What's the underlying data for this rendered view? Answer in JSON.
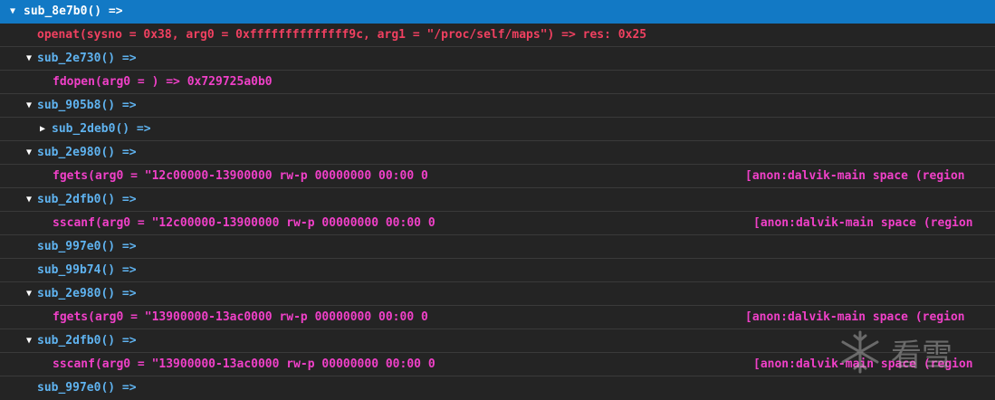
{
  "rows": [
    {
      "fn": "sub_8e7b0() =>",
      "arrow": "down"
    },
    {
      "call": "openat(sysno = 0x38, arg0 = 0xffffffffffffff9c, arg1 = \"/proc/self/maps\") => res: 0x25"
    },
    {
      "fn": "sub_2e730() =>",
      "arrow": "down"
    },
    {
      "call": "fdopen(arg0 = ) => 0x729725a0b0"
    },
    {
      "fn": "sub_905b8() =>",
      "arrow": "down"
    },
    {
      "fn": "sub_2deb0() =>",
      "arrow": "right"
    },
    {
      "fn": "sub_2e980() =>",
      "arrow": "down"
    },
    {
      "call": "fgets(arg0 = \"12c00000-13900000 rw-p 00000000 00:00 0",
      "anon": "[anon:dalvik-main space (region"
    },
    {
      "fn": "sub_2dfb0() =>",
      "arrow": "down"
    },
    {
      "call": "sscanf(arg0 = \"12c00000-13900000 rw-p 00000000 00:00 0",
      "anon": "[anon:dalvik-main space (region"
    },
    {
      "fn": "sub_997e0() =>"
    },
    {
      "fn": "sub_99b74() =>"
    },
    {
      "fn": "sub_2e980() =>",
      "arrow": "down"
    },
    {
      "call": "fgets(arg0 = \"13900000-13ac0000 rw-p 00000000 00:00 0",
      "anon": "[anon:dalvik-main space (region"
    },
    {
      "fn": "sub_2dfb0() =>",
      "arrow": "down"
    },
    {
      "call": "sscanf(arg0 = \"13900000-13ac0000 rw-p 00000000 00:00 0",
      "anon": "[anon:dalvik-main space (region"
    },
    {
      "fn": "sub_997e0() =>"
    }
  ],
  "watermark": {
    "text": "看雪"
  },
  "colors": {
    "background": "#242424",
    "selected": "#1279c5",
    "function": "#5fb3f0",
    "call": "#f040c8",
    "syscall": "#f04060"
  }
}
